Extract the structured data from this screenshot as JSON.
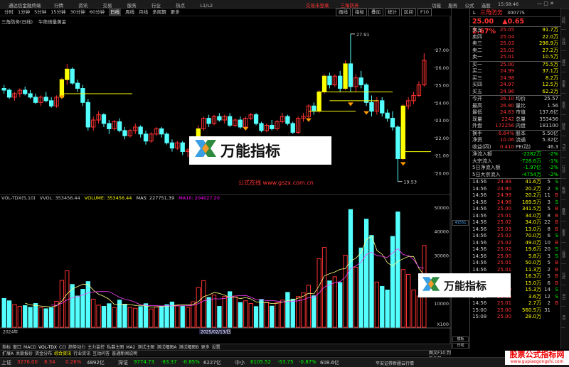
{
  "app": {
    "name": "通达信金融终端"
  },
  "menu": {
    "items": [
      "行情",
      "资讯",
      "交易",
      "服务",
      "行业",
      "热点",
      "L1/L2"
    ],
    "center": [
      "交易未登录",
      "三角防务"
    ],
    "right": [
      "功能",
      "服务",
      "公式",
      "选股"
    ],
    "clock": "15:58:46"
  },
  "periods": {
    "items": [
      "分时",
      "1分钟",
      "5分钟",
      "15分钟",
      "30分钟",
      "60分钟",
      "日线",
      "周线",
      "月线",
      "多周期",
      "更多"
    ],
    "active": "日线",
    "tools": [
      "画线",
      "指标",
      "叠加",
      "统计",
      "区间",
      "F10"
    ]
  },
  "chart_header": {
    "title": "三角防务(日线)",
    "indicator": "牛熊倍量黄金"
  },
  "vol_header": {
    "name": "VOL-TDX(5,10)",
    "vvol": "VVOL: 353456.44",
    "volume": "VOLUME: 353456.44",
    "ma5": "MA5: 227751.39",
    "ma10": "MA10: 204027.20"
  },
  "date_marker": "2025/02/13/四",
  "left_date": "2024年",
  "sel_price": "41551",
  "chart_data": {
    "type": "candlestick",
    "price_ylim": [
      19,
      28.5
    ],
    "price_ticks": [
      27.0,
      26.0,
      25.0,
      24.0,
      23.0,
      22.0,
      21.0,
      20.0
    ],
    "volume_ylim": [
      0,
      52000
    ],
    "volume_ticks": [
      "50000",
      "40000",
      "30000",
      "20000",
      "10000",
      "X100"
    ],
    "annotations": [
      {
        "label": "27.91"
      },
      {
        "label": "19.53"
      }
    ],
    "ohlc": [
      [
        24.8,
        25.0,
        24.5,
        24.7
      ],
      [
        24.7,
        24.8,
        24.2,
        24.3
      ],
      [
        24.3,
        24.6,
        24.1,
        24.5
      ],
      [
        24.5,
        24.8,
        24.3,
        24.7
      ],
      [
        24.7,
        24.9,
        24.4,
        24.5
      ],
      [
        24.5,
        24.7,
        24.2,
        24.3
      ],
      [
        24.3,
        24.5,
        23.9,
        24.0
      ],
      [
        24.0,
        24.4,
        23.8,
        24.3
      ],
      [
        24.3,
        24.6,
        24.0,
        24.1
      ],
      [
        24.1,
        24.3,
        23.7,
        23.8
      ],
      [
        23.8,
        24.4,
        23.7,
        24.3
      ],
      [
        24.3,
        25.4,
        24.2,
        25.3
      ],
      [
        25.3,
        26.2,
        25.0,
        25.9
      ],
      [
        25.9,
        26.0,
        25.0,
        25.1
      ],
      [
        25.1,
        25.3,
        24.6,
        24.8
      ],
      [
        24.8,
        25.0,
        23.8,
        24.0
      ],
      [
        24.0,
        24.2,
        22.4,
        22.6
      ],
      [
        22.6,
        23.2,
        22.4,
        23.0
      ],
      [
        23.0,
        23.5,
        22.8,
        23.3
      ],
      [
        23.3,
        23.4,
        22.6,
        22.8
      ],
      [
        22.8,
        23.0,
        22.2,
        22.5
      ],
      [
        22.5,
        23.0,
        22.4,
        22.9
      ],
      [
        22.9,
        23.1,
        22.3,
        22.4
      ],
      [
        22.4,
        22.6,
        21.9,
        22.1
      ],
      [
        22.1,
        22.5,
        22.0,
        22.4
      ],
      [
        22.4,
        22.8,
        22.2,
        22.6
      ],
      [
        22.6,
        22.7,
        22.0,
        22.2
      ],
      [
        22.2,
        22.4,
        21.6,
        21.8
      ],
      [
        21.8,
        22.3,
        21.7,
        22.2
      ],
      [
        22.2,
        22.6,
        22.1,
        22.5
      ],
      [
        22.5,
        22.6,
        22.0,
        22.2
      ],
      [
        22.2,
        22.3,
        21.6,
        21.7
      ],
      [
        21.7,
        21.9,
        21.2,
        21.4
      ],
      [
        21.4,
        21.8,
        21.3,
        21.7
      ],
      [
        21.7,
        21.8,
        21.0,
        21.2
      ],
      [
        21.2,
        21.4,
        20.9,
        21.3
      ],
      [
        21.3,
        22.1,
        21.2,
        22.0
      ],
      [
        22.0,
        22.7,
        21.9,
        22.5
      ],
      [
        22.5,
        23.2,
        22.4,
        23.1
      ],
      [
        23.1,
        23.3,
        22.6,
        22.8
      ],
      [
        22.8,
        23.3,
        22.7,
        23.2
      ],
      [
        23.2,
        23.4,
        22.9,
        23.0
      ],
      [
        23.0,
        23.3,
        22.8,
        23.2
      ],
      [
        23.2,
        23.4,
        22.6,
        22.7
      ],
      [
        22.7,
        23.1,
        22.6,
        23.0
      ],
      [
        23.0,
        23.2,
        22.5,
        22.6
      ],
      [
        22.6,
        23.2,
        22.5,
        23.1
      ],
      [
        23.1,
        23.4,
        23.0,
        23.3
      ],
      [
        23.3,
        23.4,
        22.7,
        22.8
      ],
      [
        22.8,
        22.9,
        22.3,
        22.4
      ],
      [
        22.4,
        22.8,
        22.3,
        22.7
      ],
      [
        22.7,
        23.0,
        22.4,
        22.5
      ],
      [
        22.5,
        23.0,
        22.4,
        22.9
      ],
      [
        22.9,
        23.4,
        22.8,
        23.2
      ],
      [
        23.2,
        23.3,
        22.7,
        22.8
      ],
      [
        22.8,
        22.9,
        22.2,
        22.3
      ],
      [
        22.3,
        23.2,
        22.2,
        23.1
      ],
      [
        23.1,
        23.4,
        22.9,
        23.2
      ],
      [
        23.2,
        23.9,
        23.1,
        23.8
      ],
      [
        23.8,
        24.0,
        23.3,
        23.5
      ],
      [
        23.5,
        24.7,
        23.4,
        24.6
      ],
      [
        24.6,
        25.6,
        24.5,
        25.5
      ],
      [
        25.5,
        25.7,
        24.8,
        25.0
      ],
      [
        25.0,
        25.6,
        24.9,
        25.5
      ],
      [
        25.5,
        25.8,
        24.6,
        24.8
      ],
      [
        24.8,
        26.4,
        24.7,
        26.2
      ],
      [
        26.2,
        27.9,
        24.6,
        24.9
      ],
      [
        24.9,
        25.6,
        24.6,
        25.4
      ],
      [
        25.4,
        25.8,
        24.8,
        25.0
      ],
      [
        25.0,
        25.1,
        23.8,
        24.0
      ],
      [
        24.0,
        24.4,
        23.2,
        23.5
      ],
      [
        23.5,
        24.3,
        23.3,
        24.1
      ],
      [
        24.1,
        24.3,
        23.2,
        23.4
      ],
      [
        23.4,
        23.6,
        22.9,
        23.1
      ],
      [
        23.1,
        23.5,
        22.4,
        22.6
      ],
      [
        22.6,
        22.7,
        19.5,
        20.8
      ],
      [
        20.8,
        23.9,
        20.7,
        23.8
      ],
      [
        23.8,
        24.3,
        23.6,
        24.1
      ],
      [
        24.1,
        24.6,
        23.9,
        24.4
      ],
      [
        24.4,
        25.2,
        24.3,
        25.0
      ],
      [
        25.0,
        26.8,
        24.9,
        26.4
      ]
    ],
    "volume": [
      12000,
      11000,
      9500,
      8700,
      9000,
      8300,
      9900,
      8200,
      7700,
      8100,
      10800,
      19500,
      23500,
      17800,
      13000,
      15800,
      19000,
      11700,
      9200,
      8700,
      9800,
      8200,
      11300,
      9600,
      8300,
      7900,
      8600,
      9800,
      7600,
      8500,
      8800,
      9400,
      10500,
      9100,
      8900,
      8300,
      10600,
      16500,
      19400,
      12400,
      13400,
      8700,
      12800,
      14800,
      13000,
      10300,
      11000,
      9900,
      8600,
      11600,
      10400,
      8800,
      10200,
      11300,
      14500,
      11700,
      12800,
      14300,
      17500,
      13100,
      28500,
      33200,
      19300,
      21000,
      18600,
      30000,
      49000,
      25000,
      33000,
      45000,
      38200,
      18800,
      17000,
      15500,
      37800,
      48000,
      24000,
      22000,
      15500,
      13000,
      34000
    ]
  },
  "stock": {
    "tag": "L",
    "name": "三角防务",
    "code": "300775",
    "price": "25.00",
    "change": "▲0.65",
    "pct": "2.67%"
  },
  "orderbook": {
    "asks": [
      {
        "label": "卖五",
        "price": "25.05",
        "qty": "91.7万"
      },
      {
        "label": "卖四",
        "price": "25.04",
        "qty": "22.0万"
      },
      {
        "label": "卖三",
        "price": "25.03",
        "qty": "298.9万"
      },
      {
        "label": "卖二",
        "price": "25.02",
        "qty": "27.2万"
      },
      {
        "label": "卖一",
        "price": "25.01",
        "qty": "10.5万"
      }
    ],
    "bids": [
      {
        "label": "买一",
        "price": "25.00",
        "qty": "75.5万"
      },
      {
        "label": "买二",
        "price": "24.99",
        "qty": "37.1万"
      },
      {
        "label": "买三",
        "price": "24.98",
        "qty": "8.2万"
      },
      {
        "label": "买四",
        "price": "24.97",
        "qty": "12.5万"
      },
      {
        "label": "买五",
        "price": "24.96",
        "qty": "62.2万"
      }
    ]
  },
  "stats": [
    {
      "l1": "今开",
      "v1": "26.10",
      "l2": "均价",
      "v2": "25.57"
    },
    {
      "l1": "最高",
      "v1": "26.80",
      "l2": "量比",
      "v2": "1.56"
    },
    {
      "l1": "最低",
      "v1": "24.63",
      "l2": "市值",
      "v2": "137.6亿"
    },
    {
      "l1": "现量",
      "v1": "2242",
      "l2": "总量",
      "v2": "353456"
    },
    {
      "l1": "外盘",
      "v1": "172256",
      "l2": "内盘",
      "v2": "181100"
    }
  ],
  "stats2": [
    {
      "l1": "换手",
      "v1": "6.64%",
      "l2": "股本",
      "v2": "5.50亿"
    },
    {
      "l1": "净资",
      "v1": "10.06",
      "l2": "流通",
      "v2": "5.32亿"
    },
    {
      "l1": "收益(四)",
      "v1": "0.410",
      "l2": "PE(动)",
      "v2": "46.3"
    }
  ],
  "flows": [
    {
      "label": "净流入额",
      "val": "-2282万",
      "pct": "-2%"
    },
    {
      "label": "大宗流入",
      "val": "-728.6万",
      "pct": "-1%"
    },
    {
      "label": "5日净流入额",
      "val": "-1.97亿",
      "pct": "-2%"
    },
    {
      "label": "5日大宗流入",
      "val": "-4754万",
      "pct": "-2%"
    }
  ],
  "ticks": [
    {
      "t": "14:56",
      "p": "24.89",
      "v": "41.6万",
      "s": "5",
      "d": "S"
    },
    {
      "t": "14:56",
      "p": "24.90",
      "v": "20.2万",
      "s": "2",
      "d": "S"
    },
    {
      "t": "14:56",
      "p": "24.99",
      "v": "20.2万",
      "s": "11",
      "d": "B"
    },
    {
      "t": "14:56",
      "p": "24.98",
      "v": "169.5万",
      "s": "3",
      "d": "S"
    },
    {
      "t": "14:56",
      "p": "25.00",
      "v": "341.5万",
      "s": "5",
      "d": "B"
    },
    {
      "t": "14:56",
      "p": "25.01",
      "v": "34.0万",
      "s": "8",
      "d": "B"
    },
    {
      "t": "14:56",
      "p": "25.02",
      "v": "34.0万",
      "s": "22",
      "d": "B"
    },
    {
      "t": "14:56",
      "p": "25.03",
      "v": "13.0万",
      "s": "8",
      "d": "B"
    },
    {
      "t": "14:56",
      "p": "25.02",
      "v": "70.0万",
      "s": "6",
      "d": "S"
    },
    {
      "t": "14:56",
      "p": "25.02",
      "v": "49.0万",
      "s": "10",
      "d": "B"
    },
    {
      "t": "14:56",
      "p": "25.02",
      "v": "19.6万",
      "s": "20",
      "d": "S"
    },
    {
      "t": "14:56",
      "p": "25.00",
      "v": "5.8万",
      "s": "3",
      "d": "S"
    },
    {
      "t": "14:56",
      "p": "25.01",
      "v": "50.0万",
      "s": "5",
      "d": "B"
    },
    {
      "t": "14:56",
      "p": "25.01",
      "v": "11.3万",
      "s": "2",
      "d": "B"
    },
    {
      "t": "14:56",
      "p": "25.01",
      "v": "16.3万",
      "s": "5",
      "d": "B"
    },
    {
      "t": "14:56",
      "p": "25.01",
      "v": "15.0万",
      "s": "6",
      "d": "B"
    },
    {
      "t": "14:56",
      "p": "25.00",
      "v": "15.3万",
      "s": "14",
      "d": "S"
    },
    {
      "t": "14:56",
      "p": "25.00",
      "v": "3.6万",
      "s": "12",
      "d": "S"
    },
    {
      "t": "14:56",
      "p": "25.01",
      "v": "2.7万",
      "s": "2",
      "d": "B"
    },
    {
      "t": "15:00",
      "p": "25.00",
      "v": "560.5万",
      "s": "31",
      "d": ""
    },
    {
      "t": "15:08",
      "p": "25.00",
      "v": "28.0万",
      "s": "",
      "d": ""
    }
  ],
  "sidetabs": [
    "分时",
    "日线",
    "成交",
    "资金",
    "资讯",
    "财务",
    "F10",
    "行业",
    "板块",
    "叠加",
    "更多",
    "自选",
    "公式",
    "RSI",
    "KD"
  ],
  "midstrip": [
    "模板",
    "日线"
  ],
  "bottomtabs": [
    "指标",
    "窗口",
    "MACD",
    "VOL-TDX",
    "CCI",
    "趋势动力",
    "主力监控",
    "私募主图",
    "MA2",
    "测试主图",
    "测试幅图A",
    "测试幅图B",
    "更多",
    "设置"
  ],
  "bottomtabs2": [
    "扩展A",
    "关联报价",
    "资金分布",
    "综合资讯",
    "行业资讯",
    "互动问答",
    "普通新闻说明"
  ],
  "bottomtabs2_right": "图文F10 判断例日",
  "status": {
    "indices": [
      {
        "name": "上证",
        "val": "3276.00",
        "chg": "8.34",
        "pct": "0.26%",
        "amt": "4892亿"
      },
      {
        "name": "深证",
        "val": "9774.73",
        "chg": "-83.37",
        "pct": "-0.85%",
        "amt": "6227亿"
      },
      {
        "name": "中小",
        "val": "6105.52",
        "chg": "-53.75",
        "pct": "-0.87%",
        "amt": "608.6亿"
      }
    ],
    "message": "平安证券新疆云行情"
  },
  "watermark": {
    "text": "万能指标",
    "url": "公式在线 www.gszx.com.cn",
    "corner": "股票公式指标网",
    "corner_sub": "www.gupiaogongshi.com"
  },
  "colors": {
    "up": "#ff3232",
    "down": "#54ffff",
    "yellow": "#ffff00",
    "bg": "#000000"
  }
}
